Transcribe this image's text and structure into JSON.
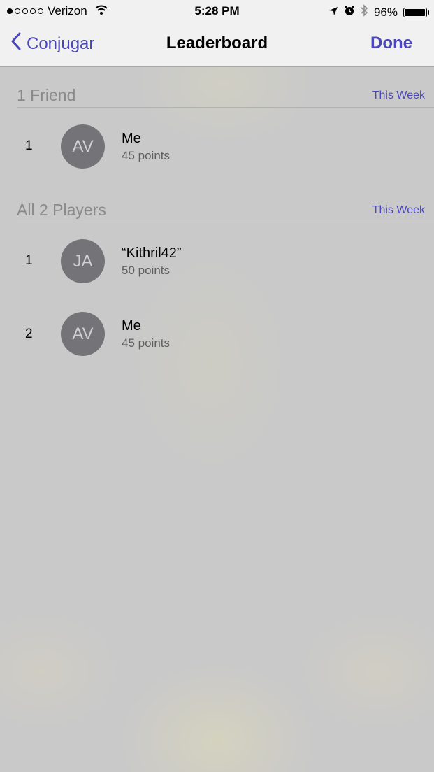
{
  "status_bar": {
    "signal_dots_filled": 1,
    "signal_dots_total": 5,
    "carrier": "Verizon",
    "wifi_icon": "wifi-icon",
    "time": "5:28 PM",
    "location_icon": "location-arrow-icon",
    "alarm_icon": "alarm-icon",
    "bluetooth_icon": "bluetooth-icon",
    "battery_percent": "96%",
    "battery_level": 0.96
  },
  "nav": {
    "back_label": "Conjugar",
    "title": "Leaderboard",
    "done_label": "Done"
  },
  "colors": {
    "accent": "#4b47b8",
    "avatar": "#747478",
    "background": "#c9c9c9"
  },
  "sections": [
    {
      "title": "1 Friend",
      "filter": "This Week",
      "rows": [
        {
          "rank": "1",
          "initials": "AV",
          "name": "Me",
          "points": "45 points"
        }
      ]
    },
    {
      "title": "All 2 Players",
      "filter": "This Week",
      "rows": [
        {
          "rank": "1",
          "initials": "JA",
          "name": "“Kithril42”",
          "points": "50 points"
        },
        {
          "rank": "2",
          "initials": "AV",
          "name": "Me",
          "points": "45 points"
        }
      ]
    }
  ]
}
